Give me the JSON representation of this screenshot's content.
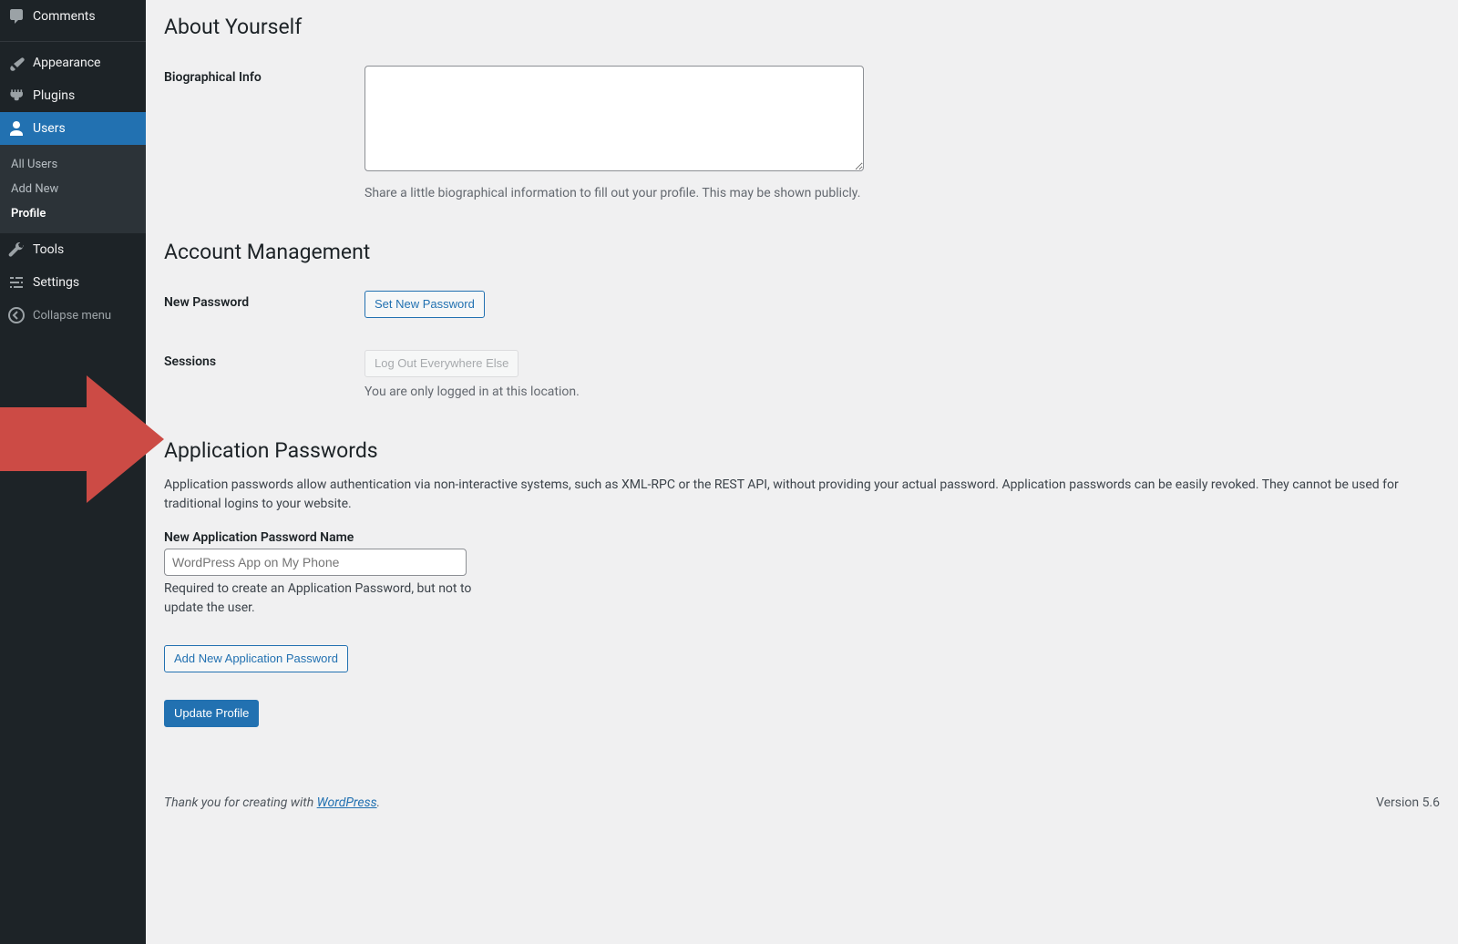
{
  "sidebar": {
    "items": [
      {
        "label": "Comments"
      },
      {
        "label": "Appearance"
      },
      {
        "label": "Plugins"
      },
      {
        "label": "Users"
      },
      {
        "label": "Tools"
      },
      {
        "label": "Settings"
      }
    ],
    "submenu": {
      "all_users": "All Users",
      "add_new": "Add New",
      "profile": "Profile"
    },
    "collapse": "Collapse menu"
  },
  "sections": {
    "about": {
      "heading": "About Yourself",
      "bio_label": "Biographical Info",
      "bio_value": "",
      "bio_help": "Share a little biographical information to fill out your profile. This may be shown publicly."
    },
    "account": {
      "heading": "Account Management",
      "new_password_label": "New Password",
      "set_password_btn": "Set New Password",
      "sessions_label": "Sessions",
      "logout_btn": "Log Out Everywhere Else",
      "sessions_help": "You are only logged in at this location."
    },
    "app_passwords": {
      "heading": "Application Passwords",
      "intro": "Application passwords allow authentication via non-interactive systems, such as XML-RPC or the REST API, without providing your actual password. Application passwords can be easily revoked. They cannot be used for traditional logins to your website.",
      "name_label": "New Application Password Name",
      "name_placeholder": "WordPress App on My Phone",
      "name_value": "",
      "name_help": "Required to create an Application Password, but not to update the user.",
      "add_btn": "Add New Application Password"
    },
    "submit": {
      "update_btn": "Update Profile"
    }
  },
  "footer": {
    "thank_prefix": "Thank you for creating with ",
    "link_text": "WordPress",
    "period": ".",
    "version": "Version 5.6"
  },
  "colors": {
    "accent": "#2271b1",
    "annotation": "#c0392b"
  }
}
